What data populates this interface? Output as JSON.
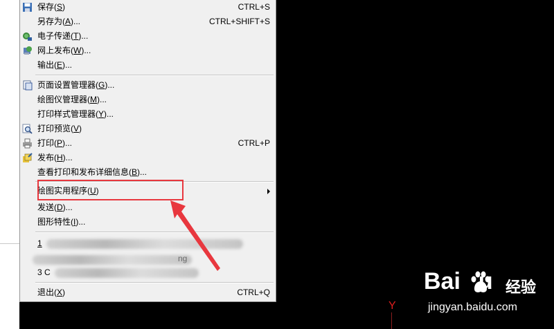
{
  "menu": {
    "items": [
      {
        "label": "保存(",
        "key": "S",
        "tail": ")",
        "shortcut": "CTRL+S"
      },
      {
        "label": "另存为(",
        "key": "A",
        "tail": ")...",
        "shortcut": "CTRL+SHIFT+S"
      },
      {
        "label": "电子传递(",
        "key": "T",
        "tail": ")...",
        "shortcut": ""
      },
      {
        "label": "网上发布(",
        "key": "W",
        "tail": ")...",
        "shortcut": ""
      },
      {
        "label": "输出(",
        "key": "E",
        "tail": ")...",
        "shortcut": ""
      },
      {
        "label": "页面设置管理器(",
        "key": "G",
        "tail": ")...",
        "shortcut": ""
      },
      {
        "label": "绘图仪管理器(",
        "key": "M",
        "tail": ")...",
        "shortcut": ""
      },
      {
        "label": "打印样式管理器(",
        "key": "Y",
        "tail": ")...",
        "shortcut": ""
      },
      {
        "label": "打印预览(",
        "key": "V",
        "tail": ")",
        "shortcut": ""
      },
      {
        "label": "打印(",
        "key": "P",
        "tail": ")...",
        "shortcut": "CTRL+P"
      },
      {
        "label": "发布(",
        "key": "H",
        "tail": ")...",
        "shortcut": ""
      },
      {
        "label": "查看打印和发布详细信息(",
        "key": "B",
        "tail": ")...",
        "shortcut": ""
      },
      {
        "label": "绘图实用程序(",
        "key": "U",
        "tail": ")",
        "shortcut": ""
      },
      {
        "label": "发送(",
        "key": "D",
        "tail": ")...",
        "shortcut": ""
      },
      {
        "label": "图形特性(",
        "key": "I",
        "tail": ")...",
        "shortcut": ""
      },
      {
        "label": "1",
        "key": "",
        "tail": "",
        "shortcut": ""
      },
      {
        "label": "3 C",
        "key": "",
        "tail": "",
        "shortcut": ""
      },
      {
        "label": "退出(",
        "key": "X",
        "tail": ")",
        "shortcut": "CTRL+Q"
      }
    ],
    "blurred_fragment": "ng"
  },
  "canvas": {
    "axis_label": "Y"
  },
  "watermark": {
    "brand": "Bai",
    "brand_tail": "u",
    "cn": "经验",
    "url": "jingyan.baidu.com"
  },
  "colors": {
    "menu_bg": "#f0f0f0",
    "highlight": "#e8373e",
    "canvas_bg": "#000000"
  }
}
